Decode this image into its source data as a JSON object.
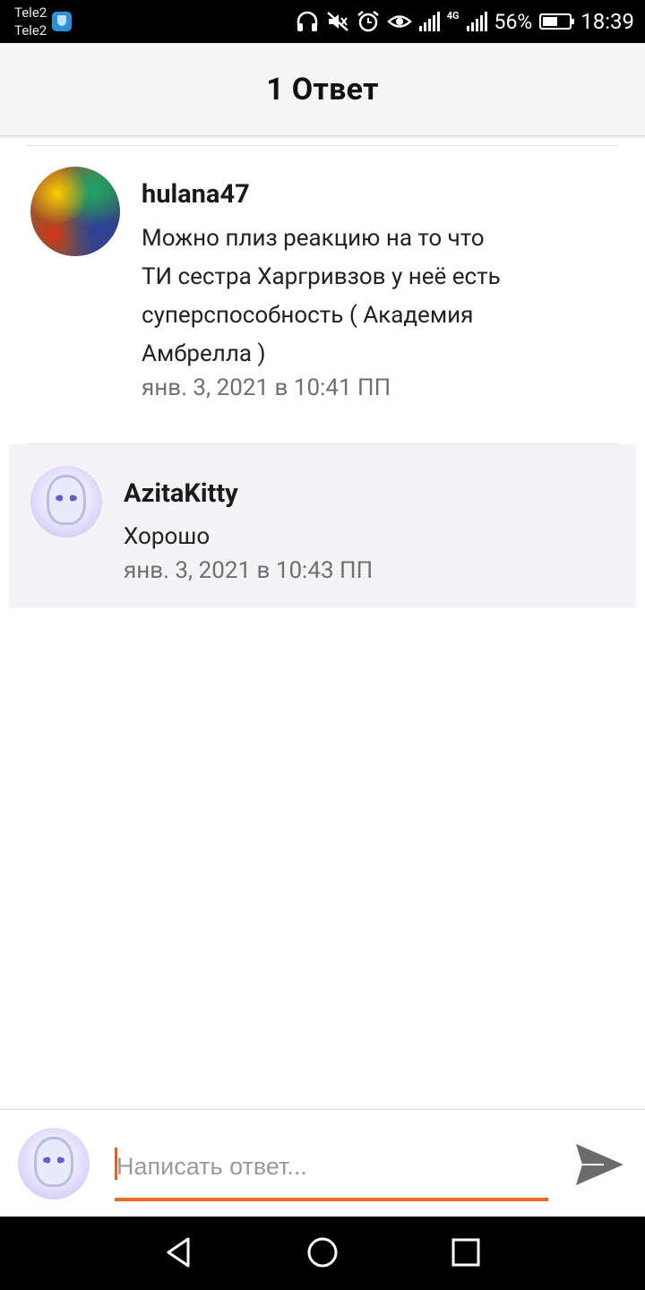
{
  "status_bar": {
    "carrier_1": "Tele2",
    "carrier_2": "Tele2",
    "network_type": "4G",
    "battery_percent": "56%",
    "time": "18:39",
    "icons": [
      "shield-icon",
      "headphones-icon",
      "mute-icon",
      "alarm-icon",
      "eye-icon",
      "signal-icon",
      "battery-icon"
    ]
  },
  "header": {
    "title": "1 Ответ"
  },
  "comments": [
    {
      "username": "hulana47",
      "lines": [
        "Можно плиз реакцию на то что",
        "ТИ сестра Харгривзов у неё есть",
        "суперспособность (  Академия",
        "Амбрелла )"
      ],
      "timestamp": "янв. 3, 2021 в 10:41 ПП"
    },
    {
      "username": "AzitaKitty",
      "lines": [
        "Хорошо"
      ],
      "timestamp": "янв. 3, 2021 в 10:43 ПП"
    }
  ],
  "reply_input": {
    "placeholder": "Написать ответ...",
    "value": ""
  },
  "colors": {
    "accent": "#ea6a24",
    "header_bg": "#f5f5f5",
    "reply_bg": "#f4f4f7",
    "send_icon": "#6b6b6b"
  }
}
